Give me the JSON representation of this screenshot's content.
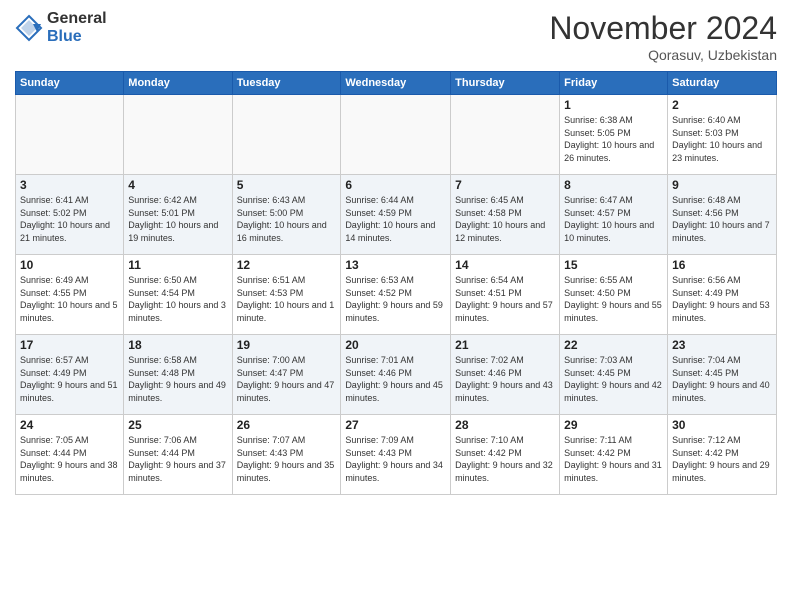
{
  "logo": {
    "text1": "General",
    "text2": "Blue"
  },
  "header": {
    "month": "November 2024",
    "location": "Qorasuv, Uzbekistan"
  },
  "weekdays": [
    "Sunday",
    "Monday",
    "Tuesday",
    "Wednesday",
    "Thursday",
    "Friday",
    "Saturday"
  ],
  "weeks": [
    [
      {
        "day": "",
        "info": ""
      },
      {
        "day": "",
        "info": ""
      },
      {
        "day": "",
        "info": ""
      },
      {
        "day": "",
        "info": ""
      },
      {
        "day": "",
        "info": ""
      },
      {
        "day": "1",
        "info": "Sunrise: 6:38 AM\nSunset: 5:05 PM\nDaylight: 10 hours and 26 minutes."
      },
      {
        "day": "2",
        "info": "Sunrise: 6:40 AM\nSunset: 5:03 PM\nDaylight: 10 hours and 23 minutes."
      }
    ],
    [
      {
        "day": "3",
        "info": "Sunrise: 6:41 AM\nSunset: 5:02 PM\nDaylight: 10 hours and 21 minutes."
      },
      {
        "day": "4",
        "info": "Sunrise: 6:42 AM\nSunset: 5:01 PM\nDaylight: 10 hours and 19 minutes."
      },
      {
        "day": "5",
        "info": "Sunrise: 6:43 AM\nSunset: 5:00 PM\nDaylight: 10 hours and 16 minutes."
      },
      {
        "day": "6",
        "info": "Sunrise: 6:44 AM\nSunset: 4:59 PM\nDaylight: 10 hours and 14 minutes."
      },
      {
        "day": "7",
        "info": "Sunrise: 6:45 AM\nSunset: 4:58 PM\nDaylight: 10 hours and 12 minutes."
      },
      {
        "day": "8",
        "info": "Sunrise: 6:47 AM\nSunset: 4:57 PM\nDaylight: 10 hours and 10 minutes."
      },
      {
        "day": "9",
        "info": "Sunrise: 6:48 AM\nSunset: 4:56 PM\nDaylight: 10 hours and 7 minutes."
      }
    ],
    [
      {
        "day": "10",
        "info": "Sunrise: 6:49 AM\nSunset: 4:55 PM\nDaylight: 10 hours and 5 minutes."
      },
      {
        "day": "11",
        "info": "Sunrise: 6:50 AM\nSunset: 4:54 PM\nDaylight: 10 hours and 3 minutes."
      },
      {
        "day": "12",
        "info": "Sunrise: 6:51 AM\nSunset: 4:53 PM\nDaylight: 10 hours and 1 minute."
      },
      {
        "day": "13",
        "info": "Sunrise: 6:53 AM\nSunset: 4:52 PM\nDaylight: 9 hours and 59 minutes."
      },
      {
        "day": "14",
        "info": "Sunrise: 6:54 AM\nSunset: 4:51 PM\nDaylight: 9 hours and 57 minutes."
      },
      {
        "day": "15",
        "info": "Sunrise: 6:55 AM\nSunset: 4:50 PM\nDaylight: 9 hours and 55 minutes."
      },
      {
        "day": "16",
        "info": "Sunrise: 6:56 AM\nSunset: 4:49 PM\nDaylight: 9 hours and 53 minutes."
      }
    ],
    [
      {
        "day": "17",
        "info": "Sunrise: 6:57 AM\nSunset: 4:49 PM\nDaylight: 9 hours and 51 minutes."
      },
      {
        "day": "18",
        "info": "Sunrise: 6:58 AM\nSunset: 4:48 PM\nDaylight: 9 hours and 49 minutes."
      },
      {
        "day": "19",
        "info": "Sunrise: 7:00 AM\nSunset: 4:47 PM\nDaylight: 9 hours and 47 minutes."
      },
      {
        "day": "20",
        "info": "Sunrise: 7:01 AM\nSunset: 4:46 PM\nDaylight: 9 hours and 45 minutes."
      },
      {
        "day": "21",
        "info": "Sunrise: 7:02 AM\nSunset: 4:46 PM\nDaylight: 9 hours and 43 minutes."
      },
      {
        "day": "22",
        "info": "Sunrise: 7:03 AM\nSunset: 4:45 PM\nDaylight: 9 hours and 42 minutes."
      },
      {
        "day": "23",
        "info": "Sunrise: 7:04 AM\nSunset: 4:45 PM\nDaylight: 9 hours and 40 minutes."
      }
    ],
    [
      {
        "day": "24",
        "info": "Sunrise: 7:05 AM\nSunset: 4:44 PM\nDaylight: 9 hours and 38 minutes."
      },
      {
        "day": "25",
        "info": "Sunrise: 7:06 AM\nSunset: 4:44 PM\nDaylight: 9 hours and 37 minutes."
      },
      {
        "day": "26",
        "info": "Sunrise: 7:07 AM\nSunset: 4:43 PM\nDaylight: 9 hours and 35 minutes."
      },
      {
        "day": "27",
        "info": "Sunrise: 7:09 AM\nSunset: 4:43 PM\nDaylight: 9 hours and 34 minutes."
      },
      {
        "day": "28",
        "info": "Sunrise: 7:10 AM\nSunset: 4:42 PM\nDaylight: 9 hours and 32 minutes."
      },
      {
        "day": "29",
        "info": "Sunrise: 7:11 AM\nSunset: 4:42 PM\nDaylight: 9 hours and 31 minutes."
      },
      {
        "day": "30",
        "info": "Sunrise: 7:12 AM\nSunset: 4:42 PM\nDaylight: 9 hours and 29 minutes."
      }
    ]
  ]
}
